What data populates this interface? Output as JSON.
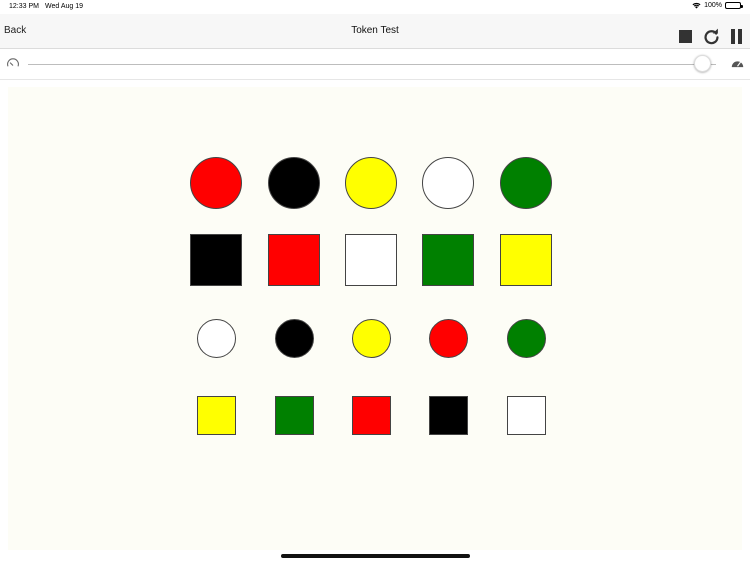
{
  "status": {
    "time": "12:33 PM",
    "date": "Wed Aug 19",
    "battery": "100%"
  },
  "nav": {
    "back_label": "Back",
    "title": "Token Test",
    "buttons": [
      "stop-icon",
      "reload-icon",
      "pause-icon"
    ]
  },
  "speed_slider": {
    "value_percent": 98,
    "min_icon": "slow-speedometer-icon",
    "max_icon": "fast-speedometer-icon"
  },
  "colors": {
    "red": "#ff0000",
    "black": "#000000",
    "yellow": "#ffff00",
    "white": "#ffffff",
    "green": "#008000"
  },
  "tokens": {
    "rows": [
      {
        "shape": "circle",
        "size": "large",
        "colors": [
          "red",
          "black",
          "yellow",
          "white",
          "green"
        ]
      },
      {
        "shape": "square",
        "size": "large",
        "colors": [
          "black",
          "red",
          "white",
          "green",
          "yellow"
        ]
      },
      {
        "shape": "circle",
        "size": "small",
        "colors": [
          "white",
          "black",
          "yellow",
          "red",
          "green"
        ]
      },
      {
        "shape": "square",
        "size": "small",
        "colors": [
          "yellow",
          "green",
          "red",
          "black",
          "white"
        ]
      }
    ]
  }
}
